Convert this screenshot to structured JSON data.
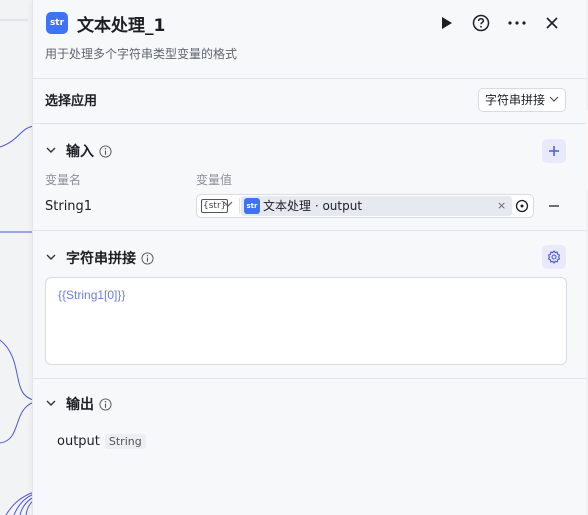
{
  "header": {
    "app_icon_text": "str",
    "title": "文本处理_1",
    "subtitle": "用于处理多个字符串类型变量的格式",
    "buttons": [
      "play-icon",
      "help-icon",
      "more-icon",
      "close-icon"
    ]
  },
  "select_app": {
    "label": "选择应用",
    "value": "字符串拼接"
  },
  "input_section": {
    "title": "输入",
    "col_name": "变量名",
    "col_value": "变量值",
    "rows": [
      {
        "name": "String1",
        "type_tag": "{str}",
        "ref_icon_text": "str",
        "ref_label": "文本处理 · output",
        "clear_glyph": "×"
      }
    ]
  },
  "concat_section": {
    "title": "字符串拼接",
    "template": "{{String1[0]}}"
  },
  "output_section": {
    "title": "输出",
    "name": "output",
    "type": "String"
  },
  "colors": {
    "accent": "#3f73f5",
    "accent_soft": "#e8eafc",
    "edge": "#4b57d8",
    "template_text": "#6b7fd6"
  }
}
